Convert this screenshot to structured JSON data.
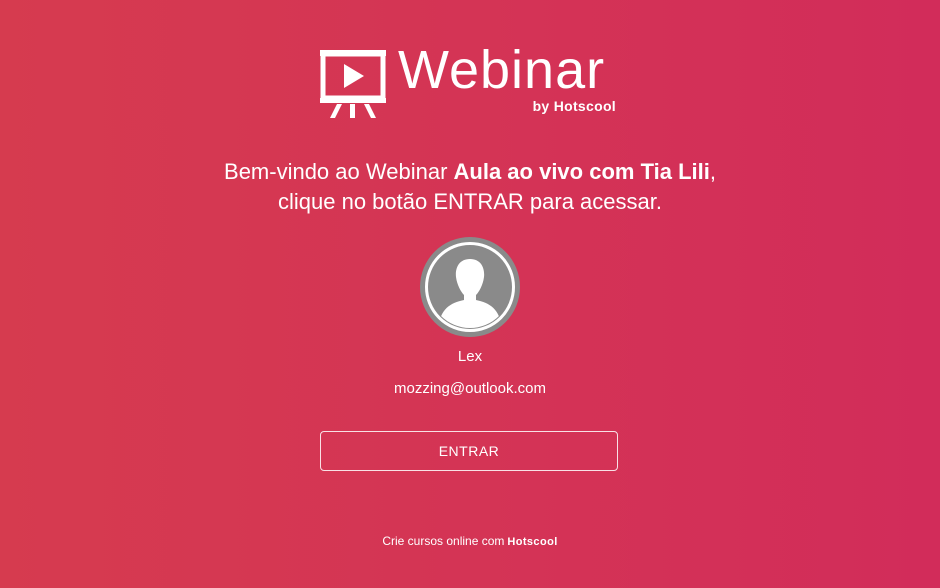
{
  "logo": {
    "icon": "presentation-screen-play-icon",
    "title": "Webinar",
    "subtitle": "by Hotscool"
  },
  "welcome": {
    "prefix": "Bem-vindo ao Webinar ",
    "event_name": "Aula ao vivo com Tia Lili",
    "suffix": ",",
    "line2": "clique no botão ENTRAR para acessar."
  },
  "user": {
    "avatar_icon": "user-avatar-icon",
    "name": "Lex",
    "email": "mozzing@outlook.com"
  },
  "actions": {
    "enter_label": "ENTRAR"
  },
  "footer": {
    "text": "Crie cursos online com",
    "brand": "Hotscool"
  },
  "colors": {
    "background_left": "#d63b4f",
    "background_right": "#d22c5a",
    "avatar_gray": "#8a8a8a",
    "text": "#ffffff"
  }
}
